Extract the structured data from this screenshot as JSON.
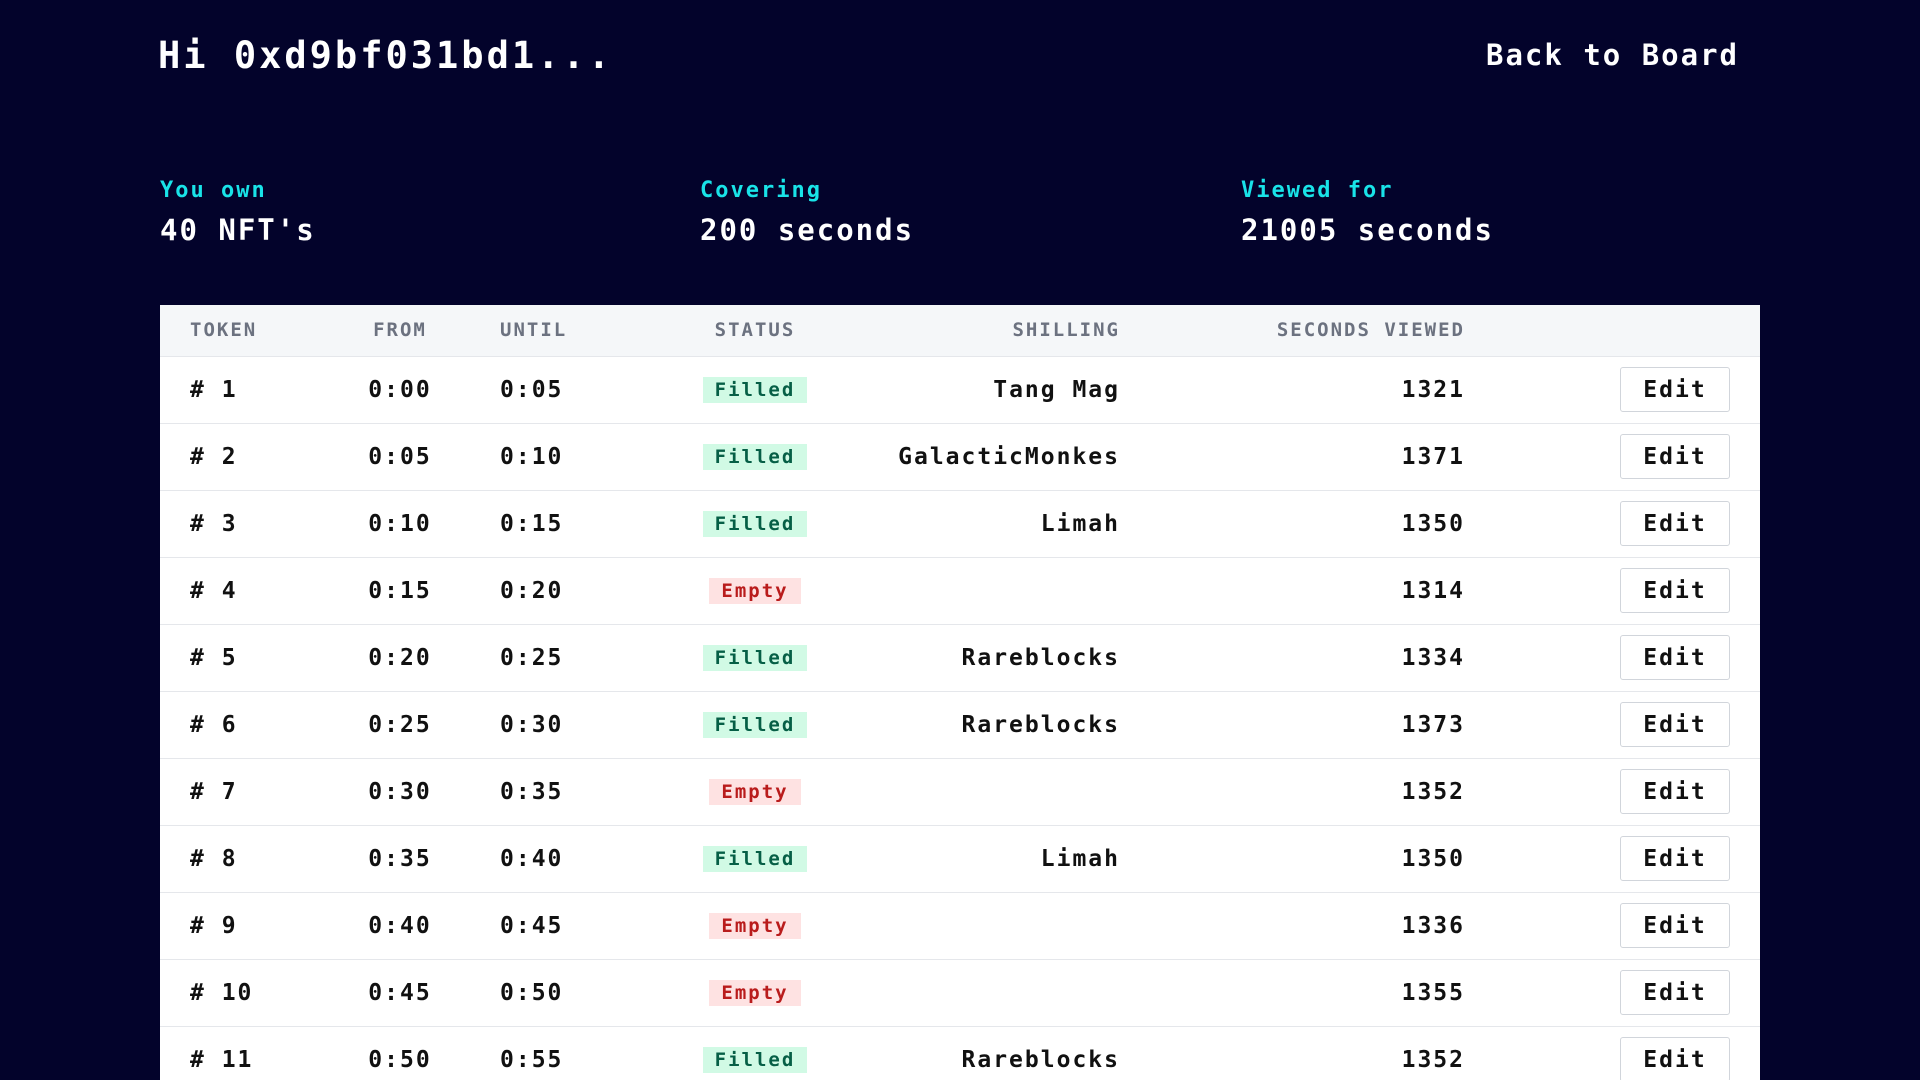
{
  "header": {
    "greeting": "Hi 0xd9bf031bd1...",
    "back_link": "Back to Board"
  },
  "stats": {
    "own": {
      "label": "You own",
      "value": "40 NFT's"
    },
    "covering": {
      "label": "Covering",
      "value": "200 seconds"
    },
    "viewed": {
      "label": "Viewed for",
      "value": "21005 seconds"
    }
  },
  "table": {
    "columns": [
      "TOKEN",
      "FROM",
      "UNTIL",
      "STATUS",
      "SHILLING",
      "SECONDS VIEWED",
      ""
    ],
    "edit_label": "Edit",
    "rows": [
      {
        "token": "# 1",
        "from": "0:00",
        "until": "0:05",
        "status": "Filled",
        "shilling": "Tang Mag",
        "seconds": "1321"
      },
      {
        "token": "# 2",
        "from": "0:05",
        "until": "0:10",
        "status": "Filled",
        "shilling": "GalacticMonkes",
        "seconds": "1371"
      },
      {
        "token": "# 3",
        "from": "0:10",
        "until": "0:15",
        "status": "Filled",
        "shilling": "Limah",
        "seconds": "1350"
      },
      {
        "token": "# 4",
        "from": "0:15",
        "until": "0:20",
        "status": "Empty",
        "shilling": "",
        "seconds": "1314"
      },
      {
        "token": "# 5",
        "from": "0:20",
        "until": "0:25",
        "status": "Filled",
        "shilling": "Rareblocks",
        "seconds": "1334"
      },
      {
        "token": "# 6",
        "from": "0:25",
        "until": "0:30",
        "status": "Filled",
        "shilling": "Rareblocks",
        "seconds": "1373"
      },
      {
        "token": "# 7",
        "from": "0:30",
        "until": "0:35",
        "status": "Empty",
        "shilling": "",
        "seconds": "1352"
      },
      {
        "token": "# 8",
        "from": "0:35",
        "until": "0:40",
        "status": "Filled",
        "shilling": "Limah",
        "seconds": "1350"
      },
      {
        "token": "# 9",
        "from": "0:40",
        "until": "0:45",
        "status": "Empty",
        "shilling": "",
        "seconds": "1336"
      },
      {
        "token": "# 10",
        "from": "0:45",
        "until": "0:50",
        "status": "Empty",
        "shilling": "",
        "seconds": "1355"
      },
      {
        "token": "# 11",
        "from": "0:50",
        "until": "0:55",
        "status": "Filled",
        "shilling": "Rareblocks",
        "seconds": "1352"
      }
    ]
  },
  "colors": {
    "background": "#03032b",
    "accent": "#19e3e8",
    "filled_bg": "#d1fae5",
    "filled_text": "#065f46",
    "empty_bg": "#fee2e2",
    "empty_text": "#b91c1c"
  }
}
